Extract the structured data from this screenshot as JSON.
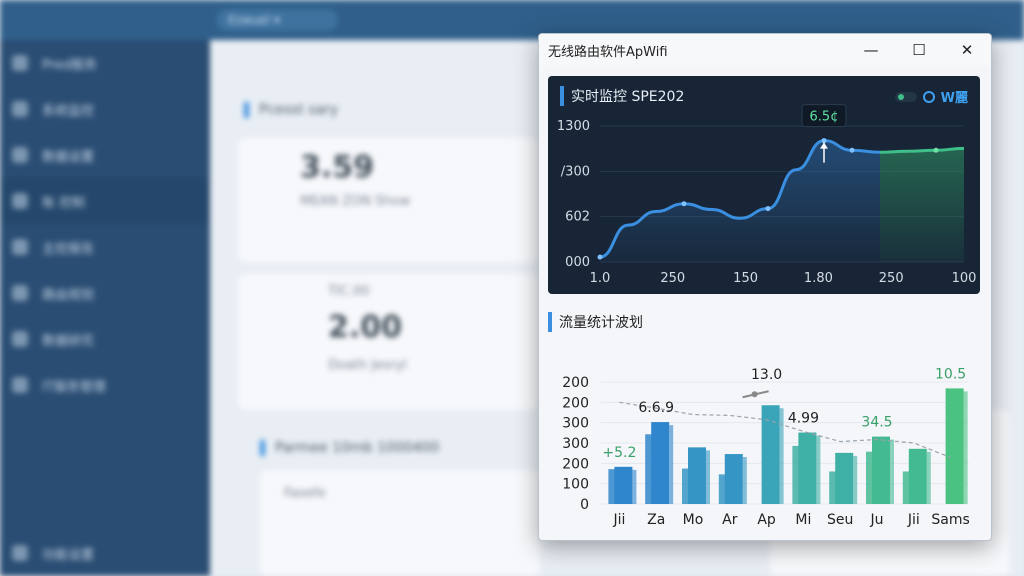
{
  "background": {
    "sidebar_items": [
      "Pred服务",
      "系统监控",
      "数据设置",
      "账 控制",
      "主控报告",
      "路由规划",
      "数据研究",
      "IT服务管理"
    ],
    "sidebar_footer": "功能设置",
    "header_tab": "Ezwuel ▾",
    "cards": {
      "section_title": "Pcesst sary",
      "card1_value": "3.59",
      "card1_sub": "MEAN ZON Show",
      "card2_label": "TIC.00",
      "card2_value": "2.00",
      "card2_sub": "Doath Jesryl",
      "section2_title": "Parmee 10mb 1000400",
      "section2_sub": "Fasefe"
    }
  },
  "window": {
    "title": "无线路由软件ApWifi",
    "controls": {
      "minimize": "—",
      "maximize": "☐",
      "close": "✕"
    }
  },
  "monitor": {
    "title": "实时监控 SPE202",
    "legend_label": "W麗",
    "peak_label": "6.5¢",
    "colors": {
      "line": "#3a8fe0",
      "line_right": "#3fbf8a",
      "panel_bg": "#172536"
    }
  },
  "chart_data": [
    {
      "type": "line",
      "title": "实时监控 SPE202",
      "x_ticks": [
        "1.0",
        "250",
        "150",
        "1.80",
        "250",
        "100"
      ],
      "y_ticks": [
        "000",
        "602",
        "/300",
        "1300"
      ],
      "series": [
        {
          "values": [
            5,
            38,
            52,
            60,
            54,
            45,
            55,
            95,
            125,
            115,
            113,
            114,
            115,
            117
          ]
        }
      ],
      "ylim": [
        0,
        140
      ]
    },
    {
      "type": "bar",
      "title": "流量统计波划",
      "categories": [
        "Jii",
        "Za",
        "Mo",
        "Ar",
        "Ap",
        "Mi",
        "Seu",
        "Ju",
        "Jii",
        "Sams"
      ],
      "series": [
        {
          "values": [
            128,
            282,
            195,
            172,
            340,
            246,
            176,
            232,
            190,
            398
          ]
        }
      ],
      "secondary_bars": [
        120,
        240,
        122,
        102,
        0,
        200,
        112,
        180,
        112,
        0
      ],
      "trend_line": [
        350,
        330,
        308,
        305,
        290,
        250,
        215,
        222,
        210,
        160
      ],
      "y_ticks": [
        "0",
        "100",
        "200",
        "300",
        "300",
        "200",
        "200"
      ],
      "data_labels": [
        {
          "category": "Jii",
          "text": "+5.2",
          "color": "#3aa06a"
        },
        {
          "category": "Za",
          "text": "6.6.9",
          "color": "#222"
        },
        {
          "category": "Ap",
          "text": "13.0",
          "color": "#222"
        },
        {
          "category": "Mi",
          "text": "4.99",
          "color": "#222"
        },
        {
          "category": "Ju",
          "text": "34.5",
          "color": "#3aa06a"
        },
        {
          "category": "Sams",
          "text": "10.5",
          "color": "#3aa06a"
        }
      ],
      "ylim": [
        0,
        420
      ],
      "colors": [
        "#2f86cc",
        "#3596c6",
        "#3aa4b8",
        "#3fb0a5",
        "#44ba92",
        "#4ac282"
      ]
    }
  ]
}
